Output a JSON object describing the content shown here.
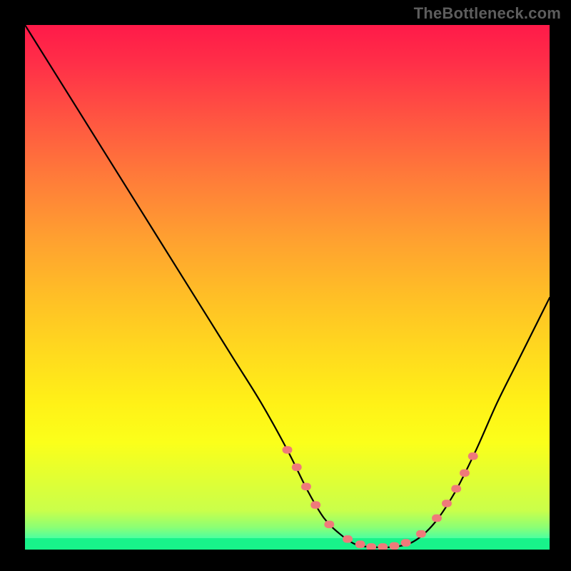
{
  "watermark": "TheBottleneck.com",
  "chart_data": {
    "type": "line",
    "title": "",
    "xlabel": "",
    "ylabel": "",
    "xlim": [
      0,
      100
    ],
    "ylim": [
      0,
      100
    ],
    "grid": false,
    "legend": false,
    "background_gradient": {
      "direction": "vertical",
      "stops": [
        {
          "pct": 0,
          "color": "#ff1a49"
        },
        {
          "pct": 20,
          "color": "#ff5741"
        },
        {
          "pct": 44,
          "color": "#ffa030"
        },
        {
          "pct": 68,
          "color": "#ffdb1e"
        },
        {
          "pct": 86,
          "color": "#fbff1a"
        },
        {
          "pct": 95,
          "color": "#8cff74"
        },
        {
          "pct": 100,
          "color": "#18f38a"
        }
      ]
    },
    "series": [
      {
        "name": "bottleneck-curve",
        "stroke": "#000000",
        "x": [
          0,
          5,
          10,
          15,
          20,
          25,
          30,
          35,
          40,
          45,
          50,
          54,
          57,
          60,
          63,
          66,
          70,
          74,
          78,
          82,
          86,
          90,
          94,
          98,
          100
        ],
        "values": [
          100,
          92,
          84,
          76,
          68,
          60,
          52,
          44,
          36,
          28,
          19,
          11,
          6,
          3,
          1,
          0.5,
          0.5,
          1.5,
          5,
          11,
          19,
          28,
          36,
          44,
          48
        ]
      }
    ],
    "markers": {
      "name": "highlight-dots",
      "color": "#ef7a7a",
      "radius_px": 7,
      "points": [
        {
          "x": 50.0,
          "y": 19.0
        },
        {
          "x": 51.8,
          "y": 15.7
        },
        {
          "x": 53.6,
          "y": 12.0
        },
        {
          "x": 55.4,
          "y": 8.5
        },
        {
          "x": 58.0,
          "y": 4.8
        },
        {
          "x": 61.5,
          "y": 2.0
        },
        {
          "x": 63.9,
          "y": 1.0
        },
        {
          "x": 66.0,
          "y": 0.5
        },
        {
          "x": 68.2,
          "y": 0.5
        },
        {
          "x": 70.4,
          "y": 0.7
        },
        {
          "x": 72.6,
          "y": 1.3
        },
        {
          "x": 75.5,
          "y": 3.0
        },
        {
          "x": 78.5,
          "y": 6.0
        },
        {
          "x": 80.4,
          "y": 8.8
        },
        {
          "x": 82.2,
          "y": 11.6
        },
        {
          "x": 83.8,
          "y": 14.6
        },
        {
          "x": 85.4,
          "y": 17.8
        }
      ]
    }
  }
}
